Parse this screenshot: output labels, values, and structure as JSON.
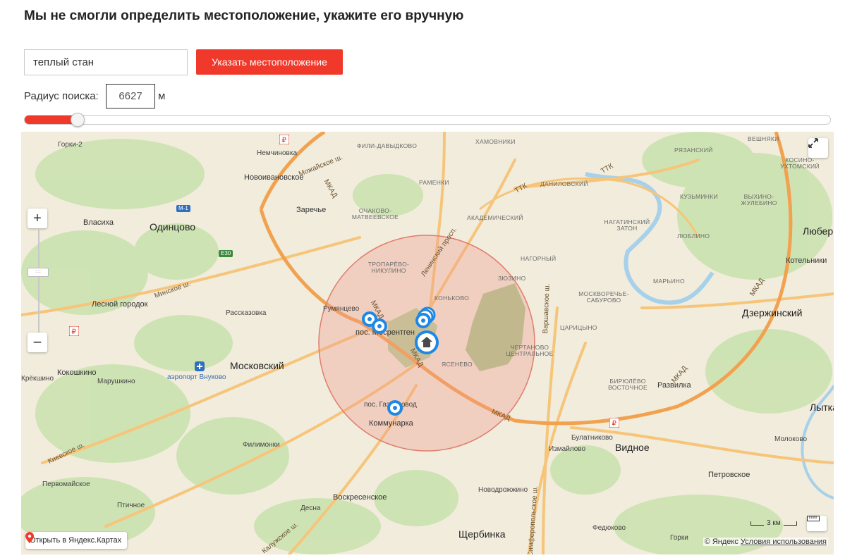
{
  "page": {
    "title": "Мы не смогли определить местоположение, укажите его вручную"
  },
  "search": {
    "value": "теплый стан",
    "button_label": "Указать местоположение"
  },
  "radius": {
    "label": "Радиус поиска:",
    "value": "6627",
    "unit": "м",
    "slider_fraction": 0.065
  },
  "map": {
    "places_major": [
      "Одинцово",
      "Московский",
      "Видное",
      "Дзержинский",
      "Щербинка",
      "Люберцы",
      "Лыткарино"
    ],
    "places": [
      "Горки-2",
      "Немчиновка",
      "Новоивановское",
      "Заречье",
      "Власиха",
      "Лесной городок",
      "Рассказовка",
      "Румянцево",
      "пос. Мосрентген",
      "пос. Газопровод",
      "Коммунарка",
      "Кокошкино",
      "Марушкино",
      "Крёкшино",
      "аэропорт Внуково",
      "Филимонки",
      "Первомайское",
      "Птичное",
      "Воскресенское",
      "Десна",
      "Новодрожжино",
      "Булатниково",
      "Измайлово",
      "Федюково",
      "Молоково",
      "Петровское",
      "Развилка",
      "Котельники",
      "Горки",
      "Вешняки"
    ],
    "districts": [
      "ФИЛИ-ДАВЫДКОВО",
      "ХАМОВНИКИ",
      "РАМЕНКИ",
      "ДАНИЛОВСКИЙ",
      "ОЧАКОВО-МАТВЕЕВСКОЕ",
      "АКАДЕМИЧЕСКИЙ",
      "ТРОПАРЁВО-НИКУЛИНО",
      "КОНЬКОВО",
      "ЗЮЗИНО",
      "НАГОРНЫЙ",
      "ЯСЕНЕВО",
      "ЧЕРТАНОВО ЦЕНТРАЛЬНОЕ",
      "ЦАРИЦЫНО",
      "МОСКВОРЕЧЬЕ-САБУРОВО",
      "НАГАТИНСКИЙ ЗАТОН",
      "ЛЮБЛИНО",
      "МАРЬИНО",
      "КУЗЬМИНКИ",
      "ВЫХИНО-ЖУЛЕБИНО",
      "РЯЗАНСКИЙ",
      "КОСИНО-УХТОМСКИЙ",
      "БИРЮЛЁВО ВОСТОЧНОЕ"
    ],
    "roads": [
      "МКАД",
      "Можайское ш.",
      "Минское ш.",
      "Киевское ш.",
      "Калужское ш.",
      "Ленинский просп.",
      "Варшавское ш.",
      "Симферопольское ш.",
      "ТТК",
      "М-1",
      "E30"
    ],
    "scale_label": "3 км",
    "open_label": "Открыть в Яндекс.Картах",
    "copyright": "© Яндекс",
    "terms_link": "Условия использования",
    "colors": {
      "accent": "#f0392a",
      "marker": "#1e88e5",
      "circle": "#f19a8c"
    }
  }
}
